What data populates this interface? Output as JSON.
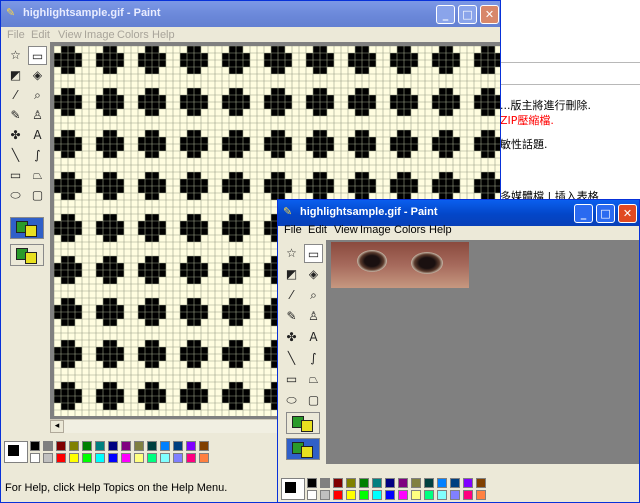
{
  "background": {
    "texts": [
      {
        "text": "...版主將進行刪除.",
        "color": "#000000"
      },
      {
        "text": "ZIP壓縮檔.",
        "color": "#ff0000"
      },
      {
        "text": "敏性話題.",
        "color": "#000000"
      },
      {
        "text": "多媒體檔 | 插入表格",
        "color": "#000000"
      }
    ]
  },
  "back_window": {
    "title": "highlightsample.gif - Paint",
    "menu": [
      "File",
      "Edit",
      "View",
      "Image",
      "Colors",
      "Help"
    ],
    "status": "For Help, click Help Topics on the Help Menu.",
    "controls": {
      "minimize": "_",
      "maximize": "□",
      "close": "✕"
    }
  },
  "front_window": {
    "title": "highlightsample.gif - Paint",
    "menu": [
      "File",
      "Edit",
      "View",
      "Image",
      "Colors",
      "Help"
    ],
    "controls": {
      "minimize": "_",
      "maximize": "□",
      "close": "✕"
    }
  },
  "tools": [
    {
      "name": "free-select-icon",
      "glyph": "☆"
    },
    {
      "name": "rect-select-icon",
      "glyph": "▭"
    },
    {
      "name": "eraser-icon",
      "glyph": "◩"
    },
    {
      "name": "fill-bucket-icon",
      "glyph": "◈"
    },
    {
      "name": "color-picker-icon",
      "glyph": "⁄"
    },
    {
      "name": "magnifier-icon",
      "glyph": "⌕"
    },
    {
      "name": "pencil-icon",
      "glyph": "✎"
    },
    {
      "name": "brush-icon",
      "glyph": "♙"
    },
    {
      "name": "airbrush-icon",
      "glyph": "✤"
    },
    {
      "name": "text-tool-icon",
      "glyph": "A"
    },
    {
      "name": "line-tool-icon",
      "glyph": "╲"
    },
    {
      "name": "curve-tool-icon",
      "glyph": "∫"
    },
    {
      "name": "rectangle-tool-icon",
      "glyph": "▭"
    },
    {
      "name": "polygon-tool-icon",
      "glyph": "⏢"
    },
    {
      "name": "ellipse-tool-icon",
      "glyph": "⬭"
    },
    {
      "name": "rounded-rect-tool-icon",
      "glyph": "▢"
    }
  ],
  "palette_colors": [
    "#000000",
    "#808080",
    "#800000",
    "#808000",
    "#008000",
    "#008080",
    "#000080",
    "#800080",
    "#808040",
    "#004040",
    "#0080ff",
    "#004080",
    "#8000ff",
    "#804000",
    "#ffffff",
    "#c0c0c0",
    "#ff0000",
    "#ffff00",
    "#00ff00",
    "#00ffff",
    "#0000ff",
    "#ff00ff",
    "#ffff80",
    "#00ff80",
    "#80ffff",
    "#8080ff",
    "#ff0080",
    "#ff8040"
  ],
  "colors": {
    "title_active": "#0346c8",
    "title_inactive": "#7c98e6",
    "canvas_bg": "#808080",
    "pattern_dark": "#000000",
    "pattern_light": "#fffde0"
  }
}
